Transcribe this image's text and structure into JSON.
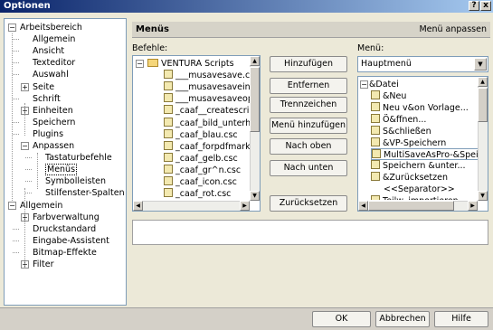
{
  "window": {
    "title": "Optionen",
    "help_btn": "?",
    "close_btn": "x"
  },
  "tree": {
    "items": [
      {
        "label": "Arbeitsbereich",
        "level": 0,
        "exp": "−"
      },
      {
        "label": "Allgemein",
        "level": 1
      },
      {
        "label": "Ansicht",
        "level": 1
      },
      {
        "label": "Texteditor",
        "level": 1
      },
      {
        "label": "Auswahl",
        "level": 1
      },
      {
        "label": "Seite",
        "level": 1,
        "exp": "+"
      },
      {
        "label": "Schrift",
        "level": 1
      },
      {
        "label": "Einheiten",
        "level": 1,
        "exp": "+"
      },
      {
        "label": "Speichern",
        "level": 1
      },
      {
        "label": "Plugins",
        "level": 1
      },
      {
        "label": "Anpassen",
        "level": 1,
        "exp": "−"
      },
      {
        "label": "Tastaturbefehle",
        "level": 2
      },
      {
        "label": "Menüs",
        "level": 2,
        "selected": true
      },
      {
        "label": "Symbolleisten",
        "level": 2
      },
      {
        "label": "Stilfenster-Spalten",
        "level": 2
      },
      {
        "label": "Allgemein",
        "level": 0,
        "exp": "−"
      },
      {
        "label": "Farbverwaltung",
        "level": 1,
        "exp": "+"
      },
      {
        "label": "Druckstandard",
        "level": 1
      },
      {
        "label": "Eingabe-Assistent",
        "level": 1
      },
      {
        "label": "Bitmap-Effekte",
        "level": 1
      },
      {
        "label": "Filter",
        "level": 1,
        "exp": "+"
      }
    ]
  },
  "header": {
    "title": "Menüs",
    "right": "Menü anpassen"
  },
  "befehle": {
    "label": "Befehle:",
    "items": [
      {
        "text": "VENTURA Scripts",
        "folder": true,
        "exp": "−"
      },
      {
        "text": "___musavesave.csc"
      },
      {
        "text": "___musavesaveinit.c"
      },
      {
        "text": "___musavesaveoper"
      },
      {
        "text": "_caaf__createscripts"
      },
      {
        "text": "_caaf_bild_unterhalb"
      },
      {
        "text": "_caaf_blau.csc"
      },
      {
        "text": "_caaf_forpdfmark.cs"
      },
      {
        "text": "_caaf_gelb.csc"
      },
      {
        "text": "_caaf_gr^n.csc"
      },
      {
        "text": "_caaf_icon.csc"
      },
      {
        "text": "_caaf_rot.csc"
      }
    ]
  },
  "buttons": {
    "hinzufuegen": "Hinzufügen",
    "entfernen": "Entfernen",
    "trennzeichen": "Trennzeichen",
    "menu_hinzufuegen": "Menü hinzufügen",
    "nach_oben": "Nach oben",
    "nach_unten": "Nach unten",
    "zuruecksetzen": "Zurücksetzen"
  },
  "menu": {
    "label": "Menü:",
    "selected": "Hauptmenü",
    "items": [
      {
        "text": "&Datei",
        "exp": "−"
      },
      {
        "text": "&Neu"
      },
      {
        "text": "Neu v&on Vorlage..."
      },
      {
        "text": "Ö&ffnen..."
      },
      {
        "text": "S&chließen"
      },
      {
        "text": "&VP-Speichern"
      },
      {
        "text": "MultiSaveAsPro-&Speiche",
        "selected": true
      },
      {
        "text": "Speichern &unter..."
      },
      {
        "text": "&Zurücksetzen"
      },
      {
        "text": "<<Separator>>",
        "noicon": true
      }
    ],
    "partial": "Teilw. importieren"
  },
  "footer": {
    "ok": "OK",
    "abbrechen": "Abbrechen",
    "hilfe": "Hilfe"
  }
}
